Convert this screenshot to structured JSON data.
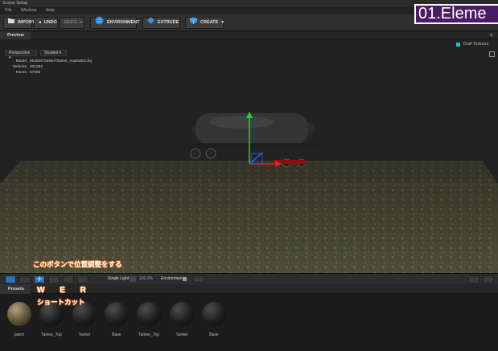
{
  "app": {
    "title": "Scene Setup",
    "overlay_title": "01.Eleme"
  },
  "menu": [
    "File",
    "Window",
    "Help"
  ],
  "toolbar": {
    "import": "IMPORT",
    "undo": "UNDO",
    "redo": "REDO",
    "environment": "ENVIRONMENT",
    "extrude": "EXTRUDE",
    "create": "CREATE"
  },
  "tabs": {
    "preview": "Preview"
  },
  "viewport": {
    "projection": "Perspective",
    "shading": "Shaded",
    "draft_textures": "Draft Textures",
    "info": [
      {
        "key": "Model:",
        "value": "Models\\Tanker\\Tanker_exploded.obj"
      },
      {
        "key": "Vertices:",
        "value": "201282"
      },
      {
        "key": "Faces:",
        "value": "67094"
      }
    ]
  },
  "bottom_toolbar": {
    "light": "Single Light",
    "light_value": "100.0%",
    "environment": "Environment"
  },
  "annotations": {
    "caption": "このボタンで位置調整をする",
    "keys": "W E R",
    "shortcut": "ショートカット"
  },
  "presets": {
    "tab": "Presets",
    "items": [
      "patch",
      "Tanker_Top",
      "Tanker",
      "Base",
      "Tanker_Top",
      "Tanker",
      "Base"
    ]
  },
  "colors": {
    "accent": "#2e6fb7",
    "overlay": "#4a1c66",
    "annotation": "#d2661c"
  }
}
